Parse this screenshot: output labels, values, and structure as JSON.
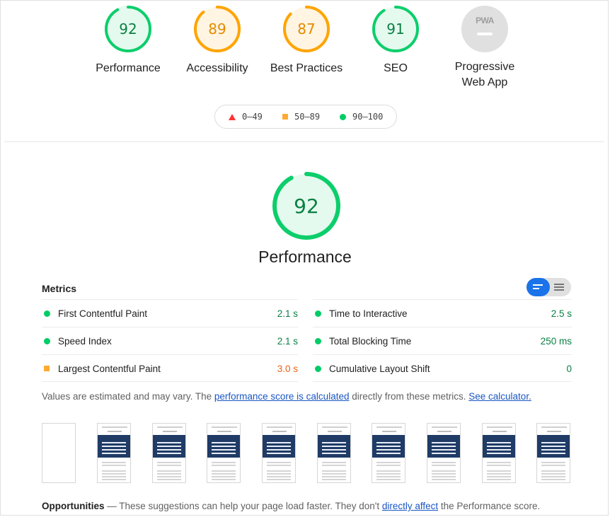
{
  "category_gauges": [
    {
      "score": "92",
      "label": "Performance",
      "status": "pass",
      "fraction": 0.92
    },
    {
      "score": "89",
      "label": "Accessibility",
      "status": "average",
      "fraction": 0.89
    },
    {
      "score": "87",
      "label": "Best Practices",
      "status": "average",
      "fraction": 0.87
    },
    {
      "score": "91",
      "label": "SEO",
      "status": "pass",
      "fraction": 0.91
    }
  ],
  "pwa": {
    "badge_text": "PWA",
    "label_line1": "Progressive",
    "label_line2": "Web App"
  },
  "legend": {
    "fail": "0–49",
    "average": "50–89",
    "pass": "90–100"
  },
  "performance": {
    "score": "92",
    "fraction": 0.92,
    "title": "Performance"
  },
  "metrics": {
    "title": "Metrics",
    "left": [
      {
        "name": "First Contentful Paint",
        "value": "2.1 s",
        "status": "pass"
      },
      {
        "name": "Speed Index",
        "value": "2.1 s",
        "status": "pass"
      },
      {
        "name": "Largest Contentful Paint",
        "value": "3.0 s",
        "status": "average"
      }
    ],
    "right": [
      {
        "name": "Time to Interactive",
        "value": "2.5 s",
        "status": "pass"
      },
      {
        "name": "Total Blocking Time",
        "value": "250 ms",
        "status": "pass"
      },
      {
        "name": "Cumulative Layout Shift",
        "value": "0",
        "status": "pass"
      }
    ]
  },
  "note": {
    "prefix": "Values are estimated and may vary. The ",
    "link1": "performance score is calculated",
    "middle": " directly from these metrics. ",
    "link2": "See calculator."
  },
  "opportunities": {
    "title": "Opportunities",
    "prefix": " — These suggestions can help your page load faster. They don't ",
    "link": "directly affect",
    "suffix": " the Performance score."
  },
  "colors": {
    "pass": "#0cce6b",
    "average": "#ffa400",
    "fail": "#ff4e42",
    "link": "#1a56c4"
  }
}
